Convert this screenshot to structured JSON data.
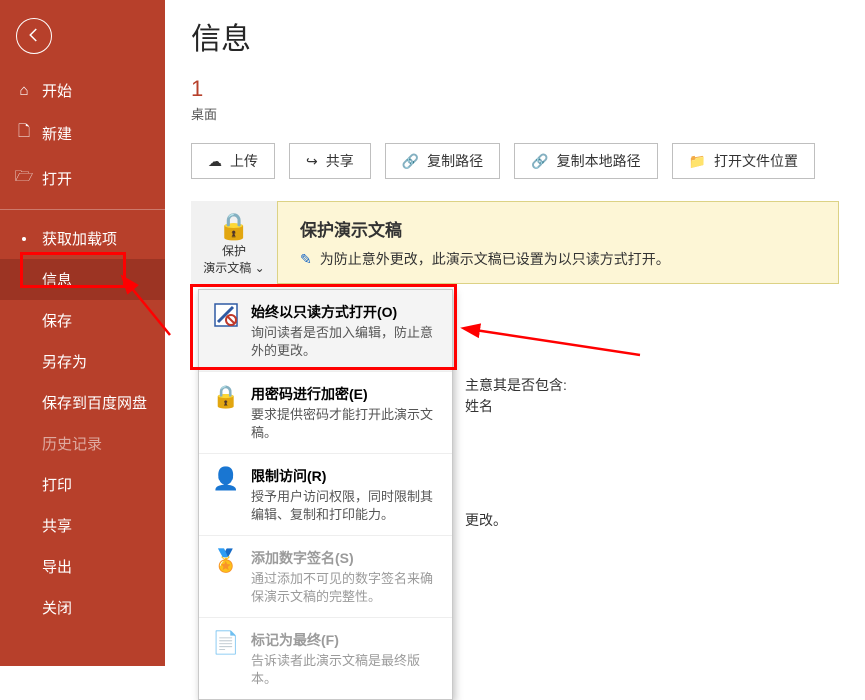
{
  "sidebar": {
    "items": [
      {
        "icon": "home-icon",
        "glyph": "⌂",
        "label": "开始"
      },
      {
        "icon": "new-icon",
        "glyph": "🗋",
        "label": "新建"
      },
      {
        "icon": "open-icon",
        "glyph": "📂",
        "label": "打开"
      },
      {
        "icon": "bullet-icon",
        "glyph": "•",
        "label": "获取加载项"
      },
      {
        "icon": "",
        "glyph": "",
        "label": "信息",
        "selected": true
      },
      {
        "icon": "",
        "glyph": "",
        "label": "保存"
      },
      {
        "icon": "",
        "glyph": "",
        "label": "另存为"
      },
      {
        "icon": "",
        "glyph": "",
        "label": "保存到百度网盘"
      },
      {
        "icon": "",
        "glyph": "",
        "label": "历史记录",
        "dim": true
      },
      {
        "icon": "",
        "glyph": "",
        "label": "打印"
      },
      {
        "icon": "",
        "glyph": "",
        "label": "共享"
      },
      {
        "icon": "",
        "glyph": "",
        "label": "导出"
      },
      {
        "icon": "",
        "glyph": "",
        "label": "关闭"
      }
    ]
  },
  "page": {
    "title": "信息",
    "doc_title": "1",
    "doc_path": "桌面"
  },
  "actions": {
    "upload": {
      "glyph": "☁",
      "label": "上传"
    },
    "share": {
      "glyph": "↪",
      "label": "共享"
    },
    "copypath": {
      "glyph": "🔗",
      "label": "复制路径"
    },
    "copylocal": {
      "glyph": "🔗",
      "label": "复制本地路径"
    },
    "openloc": {
      "glyph": "📁",
      "label": "打开文件位置"
    }
  },
  "protect": {
    "tile_line1": "保护",
    "tile_line2": "演示文稿 ⌄",
    "heading": "保护演示文稿",
    "body": "为防止意外更改，此演示文稿已设置为以只读方式打开。"
  },
  "dropdown": {
    "items": [
      {
        "icon": "readonly-icon",
        "title": "始终以只读方式打开(O)",
        "desc": "询问读者是否加入编辑，防止意外的更改。",
        "disabled": false
      },
      {
        "icon": "encrypt-icon",
        "title": "用密码进行加密(E)",
        "desc": "要求提供密码才能打开此演示文稿。",
        "disabled": false
      },
      {
        "icon": "restrict-icon",
        "title": "限制访问(R)",
        "desc": "授予用户访问权限，同时限制其编辑、复制和打印能力。",
        "disabled": false
      },
      {
        "icon": "sign-icon",
        "title": "添加数字签名(S)",
        "desc": "通过添加不可见的数字签名来确保演示文稿的完整性。",
        "disabled": true
      },
      {
        "icon": "final-icon",
        "title": "标记为最终(F)",
        "desc": "告诉读者此演示文稿是最终版本。",
        "disabled": true
      }
    ]
  },
  "side_text": {
    "a": "主意其是否包含:",
    "b": "姓名",
    "c": "更改。"
  }
}
